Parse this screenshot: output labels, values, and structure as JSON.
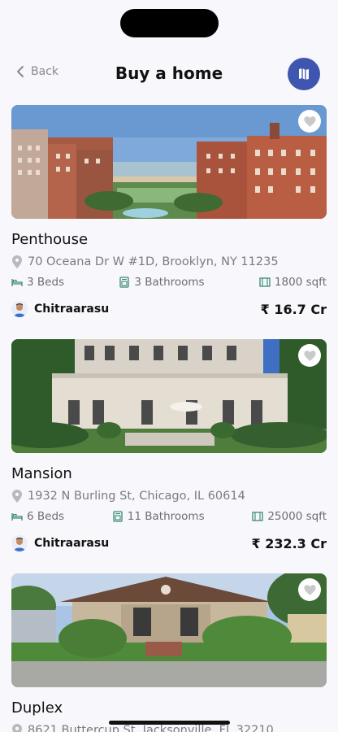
{
  "header": {
    "back_label": "Back",
    "title": "Buy a home",
    "map_icon": "map-icon",
    "accent": "#3f56b0"
  },
  "listings": [
    {
      "name": "Penthouse",
      "address": "70 Oceana Dr W #1D, Brooklyn, NY 11235",
      "beds": "3 Beds",
      "baths": "3 Bathrooms",
      "area": "1800 sqft",
      "agent": "Chitraarasu",
      "price": "₹ 16.7 Cr"
    },
    {
      "name": "Mansion",
      "address": "1932 N Burling St, Chicago, IL 60614",
      "beds": "6 Beds",
      "baths": "11 Bathrooms",
      "area": "25000 sqft",
      "agent": "Chitraarasu",
      "price": "₹ 232.3 Cr"
    },
    {
      "name": "Duplex",
      "address": "8621 Buttercup St, Jacksonville, FL 32210"
    }
  ]
}
